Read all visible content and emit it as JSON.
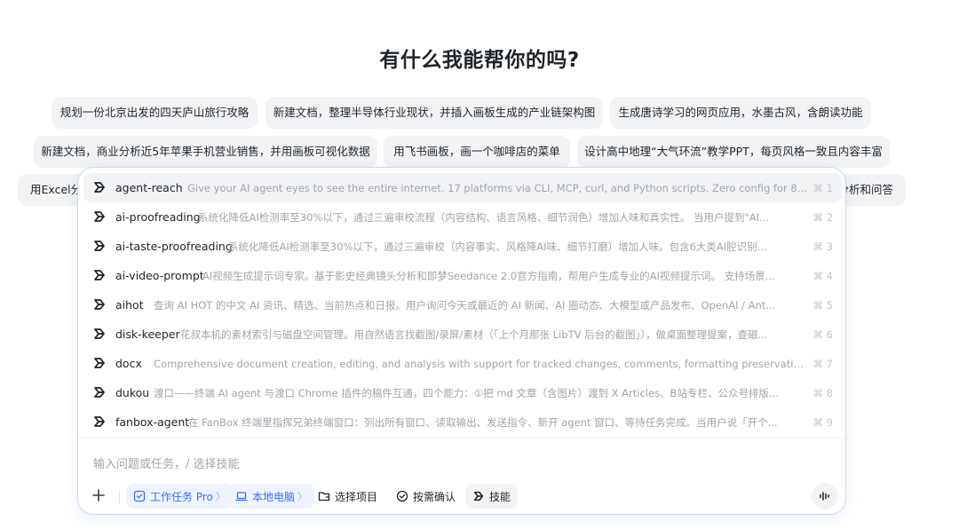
{
  "heading": "有什么我能帮你的吗?",
  "suggestions": [
    "规划一份北京出发的四天庐山旅行攻略",
    "新建文档，整理半导体行业现状，并插入画板生成的产业链架构图",
    "生成唐诗学习的网页应用，水墨古风，含朗读功能",
    "新建文档，商业分析近5年苹果手机营业销售，并用画板可视化数据",
    "用飞书画板，画一个咖啡店的菜单",
    "设计高中地理“大气环流”教学PPT，每页风格一致且内容丰富",
    "用Excel分",
    "分析和问答"
  ],
  "skills": [
    {
      "name": "agent-reach",
      "desc": "Give your AI agent eyes to see the entire internet. 17 platforms via CLI, MCP, curl, and Python scripts. Zero config for 8 cha...",
      "shortcut": "⌘ 1"
    },
    {
      "name": "ai-proofreading",
      "desc": "系统化降低AI检测率至30%以下，通过三遍审校流程（内容结构、语言风格、细节润色）增加人味和真实性。 当用户提到\"AI...",
      "shortcut": "⌘ 2"
    },
    {
      "name": "ai-taste-proofreading",
      "desc": "系统化降低AI检测率至30%以下，通过三遍审校（内容事实、风格降AI味、细节打磨）增加人味。包含6大类AI腔识别...",
      "shortcut": "⌘ 3"
    },
    {
      "name": "ai-video-prompt",
      "desc": "AI视频生成提示词专家。基于影史经典镜头分析和即梦Seedance 2.0官方指南，帮用户生成专业的AI视频提示词。 支持场景...",
      "shortcut": "⌘ 4"
    },
    {
      "name": "aihot",
      "desc": "查询 AI HOT 的中文 AI 资讯、精选、当前热点和日报。用户询问今天或最近的 AI 新闻、AI 圈动态、大模型或产品发布、OpenAI / Ant...",
      "shortcut": "⌘ 5"
    },
    {
      "name": "disk-keeper",
      "desc": "花叔本机的素材索引与磁盘空间管理。用自然语言找截图/录屏/素材（「上个月那张 LibTV 后台的截图」），做桌面整理提案，查磁...",
      "shortcut": "⌘ 6"
    },
    {
      "name": "docx",
      "desc": "Comprehensive document creation, editing, and analysis with support for tracked changes, comments, formatting preservation, ...",
      "shortcut": "⌘ 7"
    },
    {
      "name": "dukou",
      "desc": "渡口——终端 AI agent 与渡口 Chrome 插件的稿件互通，四个能力：①把 md 文章（含图片）渡到 X Articles、B站专栏、公众号排版...",
      "shortcut": "⌘ 8"
    },
    {
      "name": "fanbox-agent",
      "desc": "在 FanBox 终端里指挥兄弟终端窗口：列出所有窗口、读取输出、发送指令、新开 agent 窗口、等待任务完成。当用户说「开个...",
      "shortcut": "⌘ 9"
    }
  ],
  "input": {
    "placeholder": "输入问题或任务，/ 选择技能"
  },
  "toolbar": {
    "work_task": "工作任务 Pro",
    "local_pc": "本地电脑",
    "select_project": "选择项目",
    "confirm": "按需确认",
    "skills": "技能"
  },
  "colors": {
    "accent": "#3370ff",
    "border": "#c9d8f5",
    "chip_bg": "#f2f3f5"
  }
}
